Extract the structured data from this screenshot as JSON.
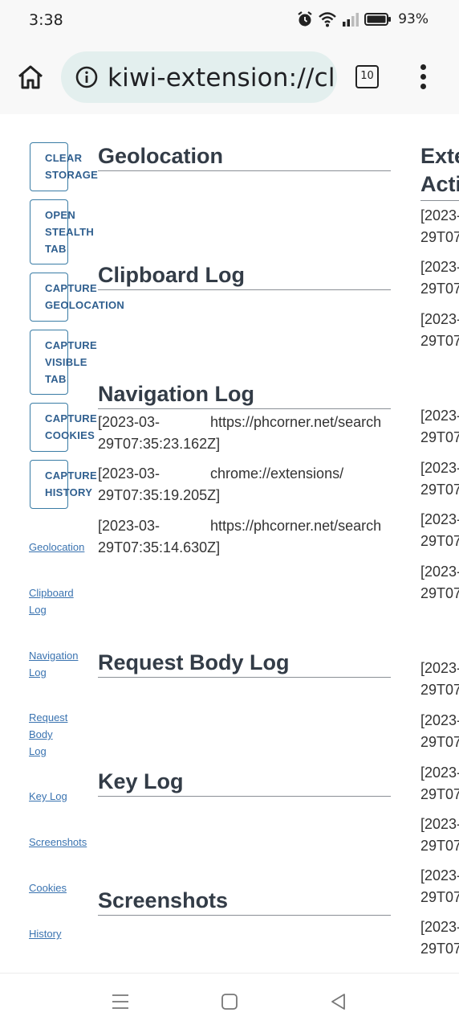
{
  "status_bar": {
    "time": "3:38",
    "battery_percent": "93%",
    "icons": [
      "alarm-icon",
      "wifi-icon",
      "signal-icon",
      "battery-icon"
    ]
  },
  "browser": {
    "url": "kiwi-extension://cl",
    "tab_count": "10",
    "icons": [
      "home-icon",
      "info-icon",
      "tabs-icon",
      "more-menu-icon"
    ]
  },
  "sidebar": {
    "buttons": [
      {
        "label": "CLEAR\nSTORAGE"
      },
      {
        "label": "OPEN\nSTEALTH\nTAB"
      },
      {
        "label": "CAPTURE\nGEOLOCATION"
      },
      {
        "label": "CAPTURE\nVISIBLE\nTAB"
      },
      {
        "label": "CAPTURE\nCOOKIES"
      },
      {
        "label": "CAPTURE\nHISTORY"
      }
    ],
    "links": [
      {
        "label": "Geolocation"
      },
      {
        "label": "Clipboard\nLog"
      },
      {
        "label": "Navigation\nLog"
      },
      {
        "label": "Request\nBody\nLog"
      },
      {
        "label": "Key Log"
      },
      {
        "label": "Screenshots"
      },
      {
        "label": "Cookies"
      },
      {
        "label": "History"
      }
    ]
  },
  "sections": {
    "geolocation": "Geolocation",
    "clipboard": "Clipboard Log",
    "navigation": "Navigation Log",
    "request_body": "Request Body Log",
    "key_log": "Key Log",
    "screenshots": "Screenshots"
  },
  "navigation_log": [
    {
      "ts1": "[2023-03-",
      "ts2": "29T07:35:23.162Z]",
      "url": "https://phcorner.net/search"
    },
    {
      "ts1": "[2023-03-",
      "ts2": "29T07:35:19.205Z]",
      "url": "chrome://extensions/"
    },
    {
      "ts1": "[2023-03-",
      "ts2": "29T07:35:14.630Z]",
      "url": "https://phcorner.net/search"
    }
  ],
  "right_column": {
    "heading_line1": "Exte",
    "heading_line2": "Acti",
    "entries": [
      {
        "a": "[2023-",
        "b": "29T07"
      },
      {
        "a": "[2023-",
        "b": "29T07"
      },
      {
        "a": "[2023-",
        "b": "29T07"
      },
      {
        "a": "[2023-",
        "b": "29T07"
      },
      {
        "a": "[2023-",
        "b": "29T07"
      },
      {
        "a": "[2023-",
        "b": "29T07"
      },
      {
        "a": "[2023-",
        "b": "29T07"
      },
      {
        "a": "[2023-",
        "b": "29T07"
      },
      {
        "a": "[2023-",
        "b": "29T07"
      },
      {
        "a": "[2023-",
        "b": "29T07"
      },
      {
        "a": "[2023-",
        "b": "29T07"
      },
      {
        "a": "[2023-",
        "b": "29T07"
      },
      {
        "a": "[2023-",
        "b": "29T07"
      }
    ]
  },
  "system_nav": {
    "icons": [
      "recents-icon",
      "home-square-icon",
      "back-icon"
    ]
  }
}
